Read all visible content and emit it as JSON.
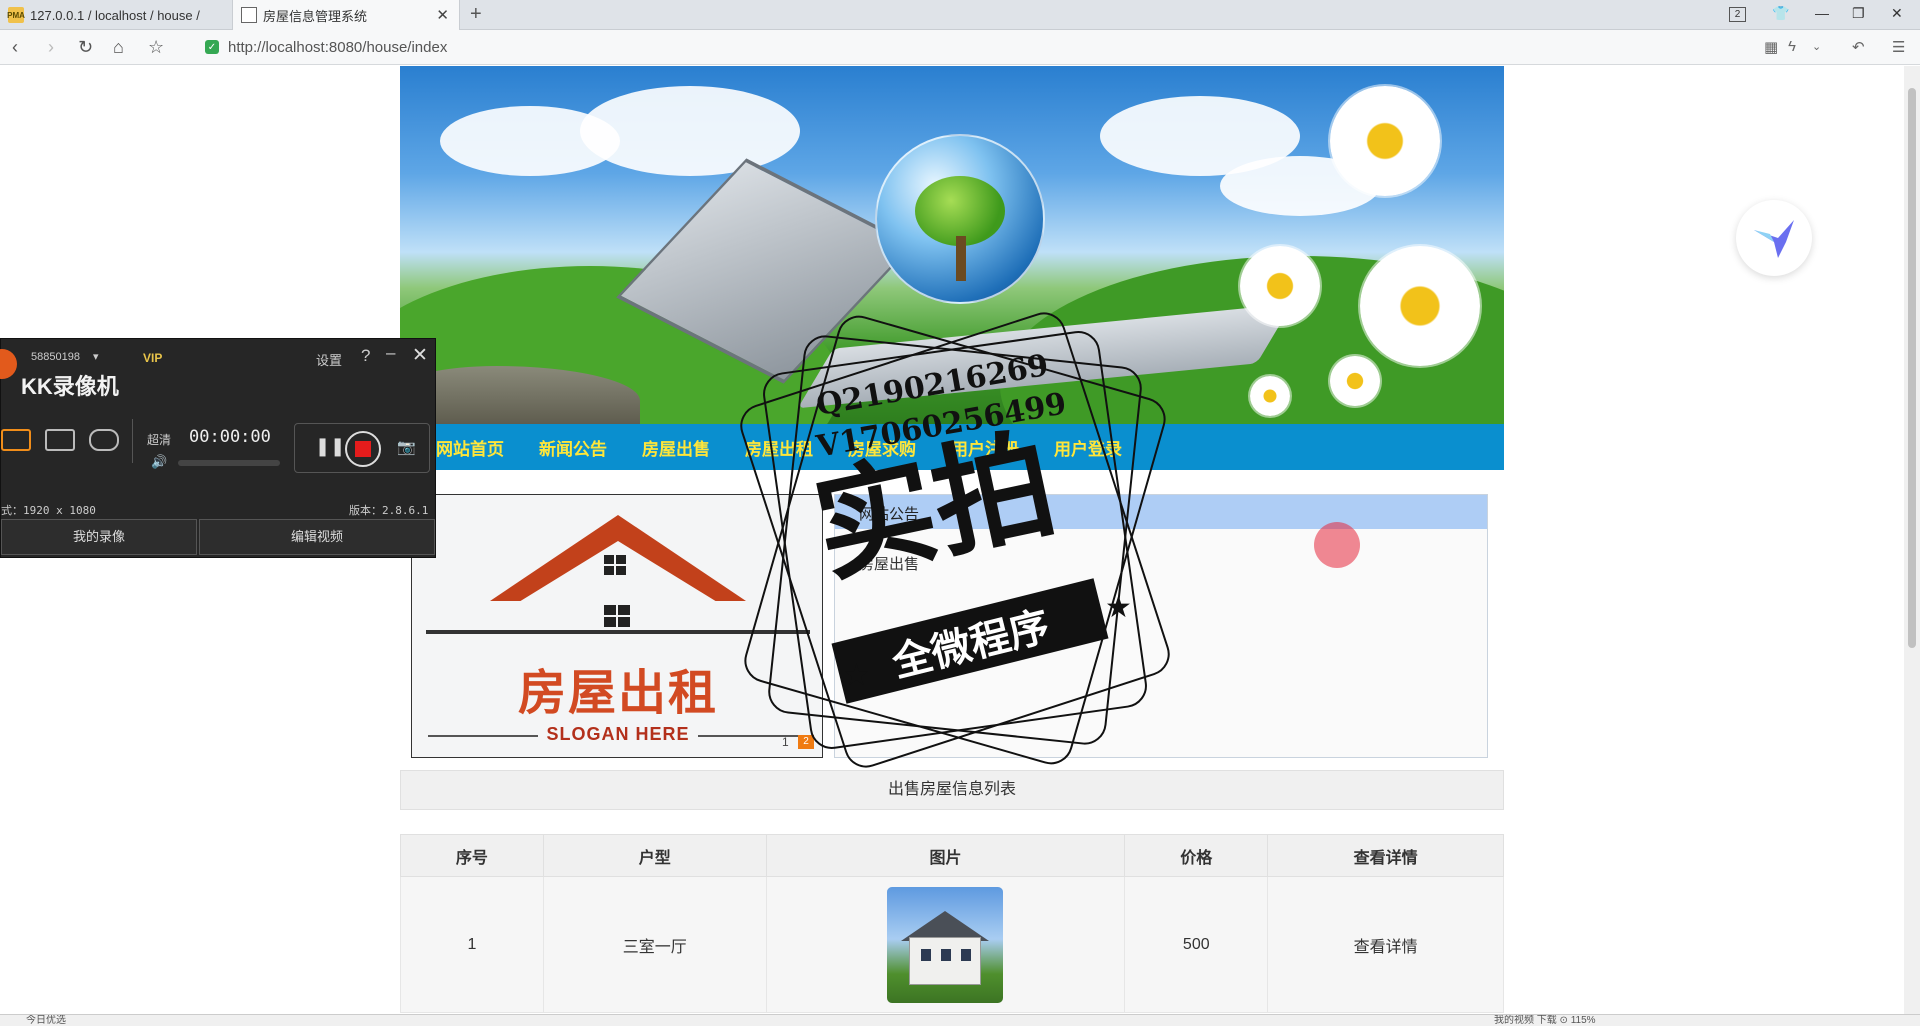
{
  "browser": {
    "tabs": [
      {
        "title": "127.0.0.1 / localhost / house /",
        "favicon": "pma-icon",
        "favicon_text": "PMA"
      },
      {
        "title": "房屋信息管理系统",
        "favicon": "page-icon"
      }
    ],
    "tab_count": "2",
    "url_host": "http://localhost",
    "url_rest": ":8080/house/index"
  },
  "page": {
    "nav": [
      "网站首页",
      "新闻公告",
      "房屋出售",
      "房屋出租",
      "房屋求购",
      "用户注册",
      "用户登录"
    ],
    "logo": {
      "cn": "房屋出租",
      "slogan": "SLOGAN HERE",
      "badge_num": "1",
      "badge_orange": "2"
    },
    "notice": {
      "title": "网站公告",
      "text": "房屋出售"
    },
    "list_title": "出售房屋信息列表",
    "table": {
      "headers": [
        "序号",
        "户型",
        "图片",
        "价格",
        "查看详情"
      ],
      "rows": [
        {
          "id": "1",
          "type": "三室一厅",
          "price": "500",
          "detail": "查看详情"
        }
      ]
    }
  },
  "recorder": {
    "user_id": "58850198",
    "vip": "VIP",
    "app_name": "KK录像机",
    "settings": "设置",
    "help": "?",
    "quality": "超清",
    "time": "00:00:00",
    "format": "式：1920 x 1080",
    "version": "版本：2.8.6.1",
    "btn_my_recordings": "我的录像",
    "btn_edit_video": "编辑视频"
  },
  "stamp": {
    "qq": "Q2190216269",
    "wx": "V17060256499",
    "big": "实拍",
    "band": "全微程序"
  },
  "statusbar": {
    "left": "今日优选",
    "right": "我的视频   下载   ⊙ 115%"
  },
  "colors": {
    "navbar": "#0a8fcf",
    "nav_text": "#ffe63a",
    "notice_head": "#aecdf5",
    "logo_red": "#d24a22",
    "record_red": "#e51c1c"
  }
}
